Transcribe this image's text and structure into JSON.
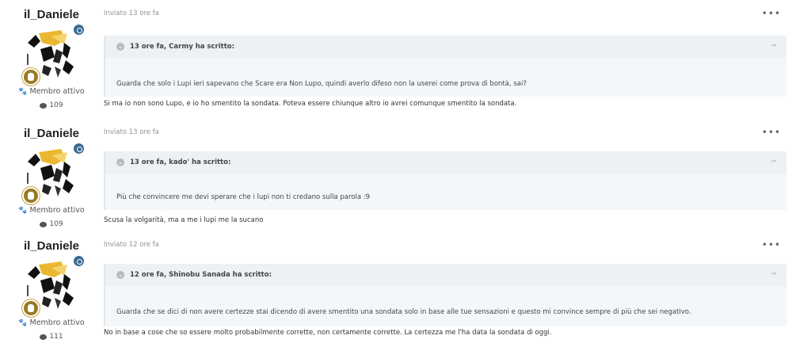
{
  "posts": [
    {
      "author": "il_Daniele",
      "rank": "Membro attivo",
      "post_count": "109",
      "meta": "Inviato 13 ore fa",
      "more": "•••",
      "quote_header": "13 ore fa, Carmy ha scritto:",
      "quote_text": "Guarda che solo i Lupi ieri sapevano che Scare era Non Lupo, quindi averlo difeso non la userei come prova di bontà, sai?",
      "reply": "Si ma io non sono Lupo, e io ho smentito la sondata. Poteva essere chiunque altro io avrei comunque smentito la sondata."
    },
    {
      "author": "il_Daniele",
      "rank": "Membro attivo",
      "post_count": "109",
      "meta": "Inviato 13 ore fa",
      "more": "•••",
      "quote_header": "13 ore fa, kado' ha scritto:",
      "quote_text": "Più che convincere me devi sperare che i lupi non ti credano sulla parola :9",
      "reply": "Scusa la volgarità, ma a me i lupi me la sucano"
    },
    {
      "author": "il_Daniele",
      "rank": "Membro attivo",
      "post_count": "111",
      "meta": "Inviato 12 ore fa",
      "more": "•••",
      "quote_header": "12 ore fa, Shinobu Sanada ha scritto:",
      "quote_text": "Guarda che se dici di non avere certezze stai dicendo di avere smentito una sondata solo in base alle tue sensazioni e questo mi convince sempre di più che sei negativo.",
      "reply": "No in base a cose che so essere molto probabilmente corrette, non certamente corrette. La certezza me l'ha data la sondata di oggi."
    }
  ],
  "icons": {
    "options": "more-options-icon",
    "quote_toggle": "chevron-circle-icon",
    "quote_share": "share-arrow-icon",
    "rank": "paw-icon",
    "posts": "speech-bubble-icon"
  }
}
